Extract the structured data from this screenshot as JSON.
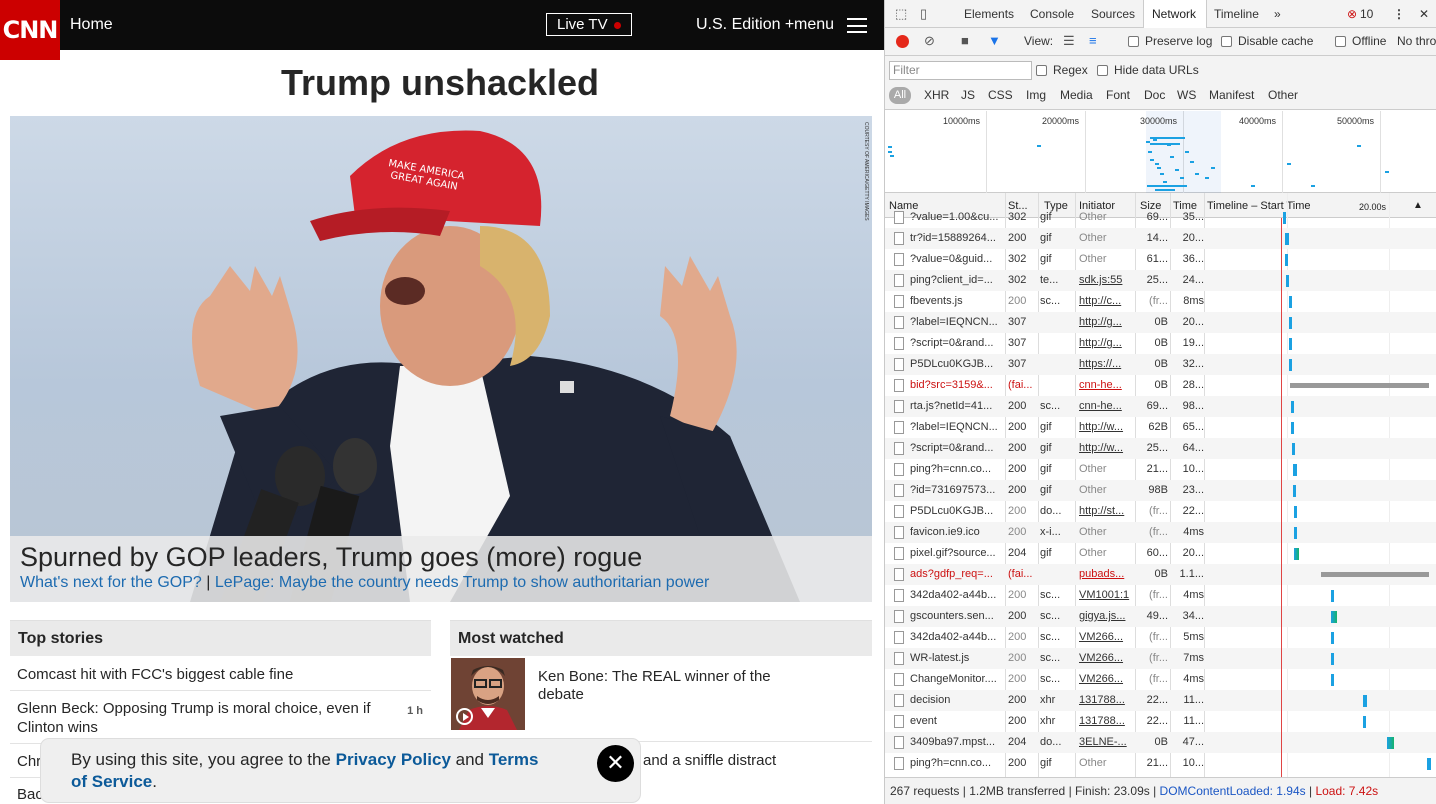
{
  "site": {
    "logo": "CNN",
    "nav_home": "Home",
    "live_tv": "Live TV",
    "edition": "U.S. Edition +",
    "menu": "menu",
    "headline": "Trump unshackled",
    "hero_caption": "Spurned by GOP leaders, Trump goes (more) rogue",
    "hero_link_1": "What's next for the GOP?",
    "hero_sep": "|",
    "hero_link_2": "LePage: Maybe the country needs Trump to show authoritarian power",
    "top_stories_title": "Top stories",
    "most_watched_title": "Most watched",
    "stories": [
      {
        "title": "Comcast hit with FCC's biggest cable fine",
        "age": ""
      },
      {
        "title": "Glenn Beck: Opposing Trump is moral choice, even if Clinton wins",
        "age": "1 h"
      },
      {
        "title": "Chr",
        "age": ""
      },
      {
        "title": "Bac",
        "age": ""
      }
    ],
    "most_watched": [
      {
        "title": "Ken Bone: The REAL winner of the debate"
      },
      {
        "title": "and a sniffle distract"
      }
    ],
    "consent_text_1": "By using this site, you agree to the ",
    "consent_link_1": "Privacy Policy",
    "consent_text_2": " and ",
    "consent_link_2": "Terms of Service",
    "consent_text_3": ".",
    "consent_close": "✕"
  },
  "devtools": {
    "tabs": [
      "Elements",
      "Console",
      "Sources",
      "Network",
      "Timeline"
    ],
    "active_tab": "Network",
    "more_tabs": "»",
    "error_count": "10",
    "view_label": "View:",
    "preserve_log": "Preserve log",
    "disable_cache": "Disable cache",
    "offline": "Offline",
    "no_throttling": "No thro",
    "filter_placeholder": "Filter",
    "regex": "Regex",
    "hide_data_urls": "Hide data URLs",
    "types": [
      "All",
      "XHR",
      "JS",
      "CSS",
      "Img",
      "Media",
      "Font",
      "Doc",
      "WS",
      "Manifest",
      "Other"
    ],
    "overview_ticks": [
      "10000ms",
      "20000ms",
      "30000ms",
      "40000ms",
      "50000ms"
    ],
    "columns": {
      "name": "Name",
      "status": "St...",
      "type": "Type",
      "initiator": "Initiator",
      "size": "Size",
      "time": "Time",
      "timeline": "Timeline – Start Time",
      "scale": "20.00s"
    },
    "rows": [
      {
        "name": "?value=1.00&cu...",
        "status": "302",
        "type": "gif",
        "initiator": "Other",
        "size": "69...",
        "time": "35...",
        "link": false,
        "err": false
      },
      {
        "name": "tr?id=15889264...",
        "status": "200",
        "type": "gif",
        "initiator": "Other",
        "size": "14...",
        "time": "20...",
        "link": false,
        "err": false
      },
      {
        "name": "?value=0&guid...",
        "status": "302",
        "type": "gif",
        "initiator": "Other",
        "size": "61...",
        "time": "36...",
        "link": false,
        "err": false
      },
      {
        "name": "ping?client_id=...",
        "status": "302",
        "type": "te...",
        "initiator": "sdk.js:55",
        "size": "25...",
        "time": "24...",
        "link": true,
        "err": false
      },
      {
        "name": "fbevents.js",
        "status": "200",
        "type": "sc...",
        "initiator": "http://c...",
        "size": "(fr...",
        "time": "8ms",
        "link": true,
        "err": false
      },
      {
        "name": "?label=IEQNCN...",
        "status": "307",
        "type": "",
        "initiator": "http://g...",
        "size": "0B",
        "time": "20...",
        "link": true,
        "err": false
      },
      {
        "name": "?script=0&rand...",
        "status": "307",
        "type": "",
        "initiator": "http://g...",
        "size": "0B",
        "time": "19...",
        "link": true,
        "err": false
      },
      {
        "name": "P5DLcu0KGJB...",
        "status": "307",
        "type": "",
        "initiator": "https://...",
        "size": "0B",
        "time": "32...",
        "link": true,
        "err": false
      },
      {
        "name": "bid?src=3159&...",
        "status": "(fai...",
        "type": "",
        "initiator": "cnn-he...",
        "size": "0B",
        "time": "28...",
        "link": true,
        "err": true
      },
      {
        "name": "rta.js?netId=41...",
        "status": "200",
        "type": "sc...",
        "initiator": "cnn-he...",
        "size": "69...",
        "time": "98...",
        "link": true,
        "err": false
      },
      {
        "name": "?label=IEQNCN...",
        "status": "200",
        "type": "gif",
        "initiator": "http://w...",
        "size": "62B",
        "time": "65...",
        "link": true,
        "err": false
      },
      {
        "name": "?script=0&rand...",
        "status": "200",
        "type": "gif",
        "initiator": "http://w...",
        "size": "25...",
        "time": "64...",
        "link": true,
        "err": false
      },
      {
        "name": "ping?h=cnn.co...",
        "status": "200",
        "type": "gif",
        "initiator": "Other",
        "size": "21...",
        "time": "10...",
        "link": false,
        "err": false
      },
      {
        "name": "?id=731697573...",
        "status": "200",
        "type": "gif",
        "initiator": "Other",
        "size": "98B",
        "time": "23...",
        "link": false,
        "err": false
      },
      {
        "name": "P5DLcu0KGJB...",
        "status": "200",
        "type": "do...",
        "initiator": "http://st...",
        "size": "(fr...",
        "time": "22...",
        "link": true,
        "err": false
      },
      {
        "name": "favicon.ie9.ico",
        "status": "200",
        "type": "x-i...",
        "initiator": "Other",
        "size": "(fr...",
        "time": "4ms",
        "link": false,
        "err": false
      },
      {
        "name": "pixel.gif?source...",
        "status": "204",
        "type": "gif",
        "initiator": "Other",
        "size": "60...",
        "time": "20...",
        "link": false,
        "err": false
      },
      {
        "name": "ads?gdfp_req=...",
        "status": "(fai...",
        "type": "",
        "initiator": "pubads...",
        "size": "0B",
        "time": "1.1...",
        "link": true,
        "err": true
      },
      {
        "name": "342da402-a44b...",
        "status": "200",
        "type": "sc...",
        "initiator": "VM1001:1",
        "size": "(fr...",
        "time": "4ms",
        "link": true,
        "err": false
      },
      {
        "name": "gscounters.sen...",
        "status": "200",
        "type": "sc...",
        "initiator": "gigya.js...",
        "size": "49...",
        "time": "34...",
        "link": true,
        "err": false
      },
      {
        "name": "342da402-a44b...",
        "status": "200",
        "type": "sc...",
        "initiator": "VM266...",
        "size": "(fr...",
        "time": "5ms",
        "link": true,
        "err": false
      },
      {
        "name": "WR-latest.js",
        "status": "200",
        "type": "sc...",
        "initiator": "VM266...",
        "size": "(fr...",
        "time": "7ms",
        "link": true,
        "err": false
      },
      {
        "name": "ChangeMonitor....",
        "status": "200",
        "type": "sc...",
        "initiator": "VM266...",
        "size": "(fr...",
        "time": "4ms",
        "link": true,
        "err": false
      },
      {
        "name": "decision",
        "status": "200",
        "type": "xhr",
        "initiator": "131788...",
        "size": "22...",
        "time": "11...",
        "link": true,
        "err": false
      },
      {
        "name": "event",
        "status": "200",
        "type": "xhr",
        "initiator": "131788...",
        "size": "22...",
        "time": "11...",
        "link": true,
        "err": false
      },
      {
        "name": "3409ba97.mpst...",
        "status": "204",
        "type": "do...",
        "initiator": "3ELNE-...",
        "size": "0B",
        "time": "47...",
        "link": true,
        "err": false
      },
      {
        "name": "ping?h=cnn.co...",
        "status": "200",
        "type": "gif",
        "initiator": "Other",
        "size": "21...",
        "time": "10...",
        "link": false,
        "err": false
      }
    ],
    "status_requests": "267 requests",
    "status_transferred": "1.2MB transferred",
    "status_finish": "Finish: 23.09s",
    "status_dcl": "DOMContentLoaded: 1.94s",
    "status_load": "Load: 7.42s"
  },
  "colors": {
    "cnn_red": "#cc0000",
    "link_blue": "#1d6bb0",
    "devtools_bar": "#1ba1e2",
    "error_red": "#cc1111"
  }
}
